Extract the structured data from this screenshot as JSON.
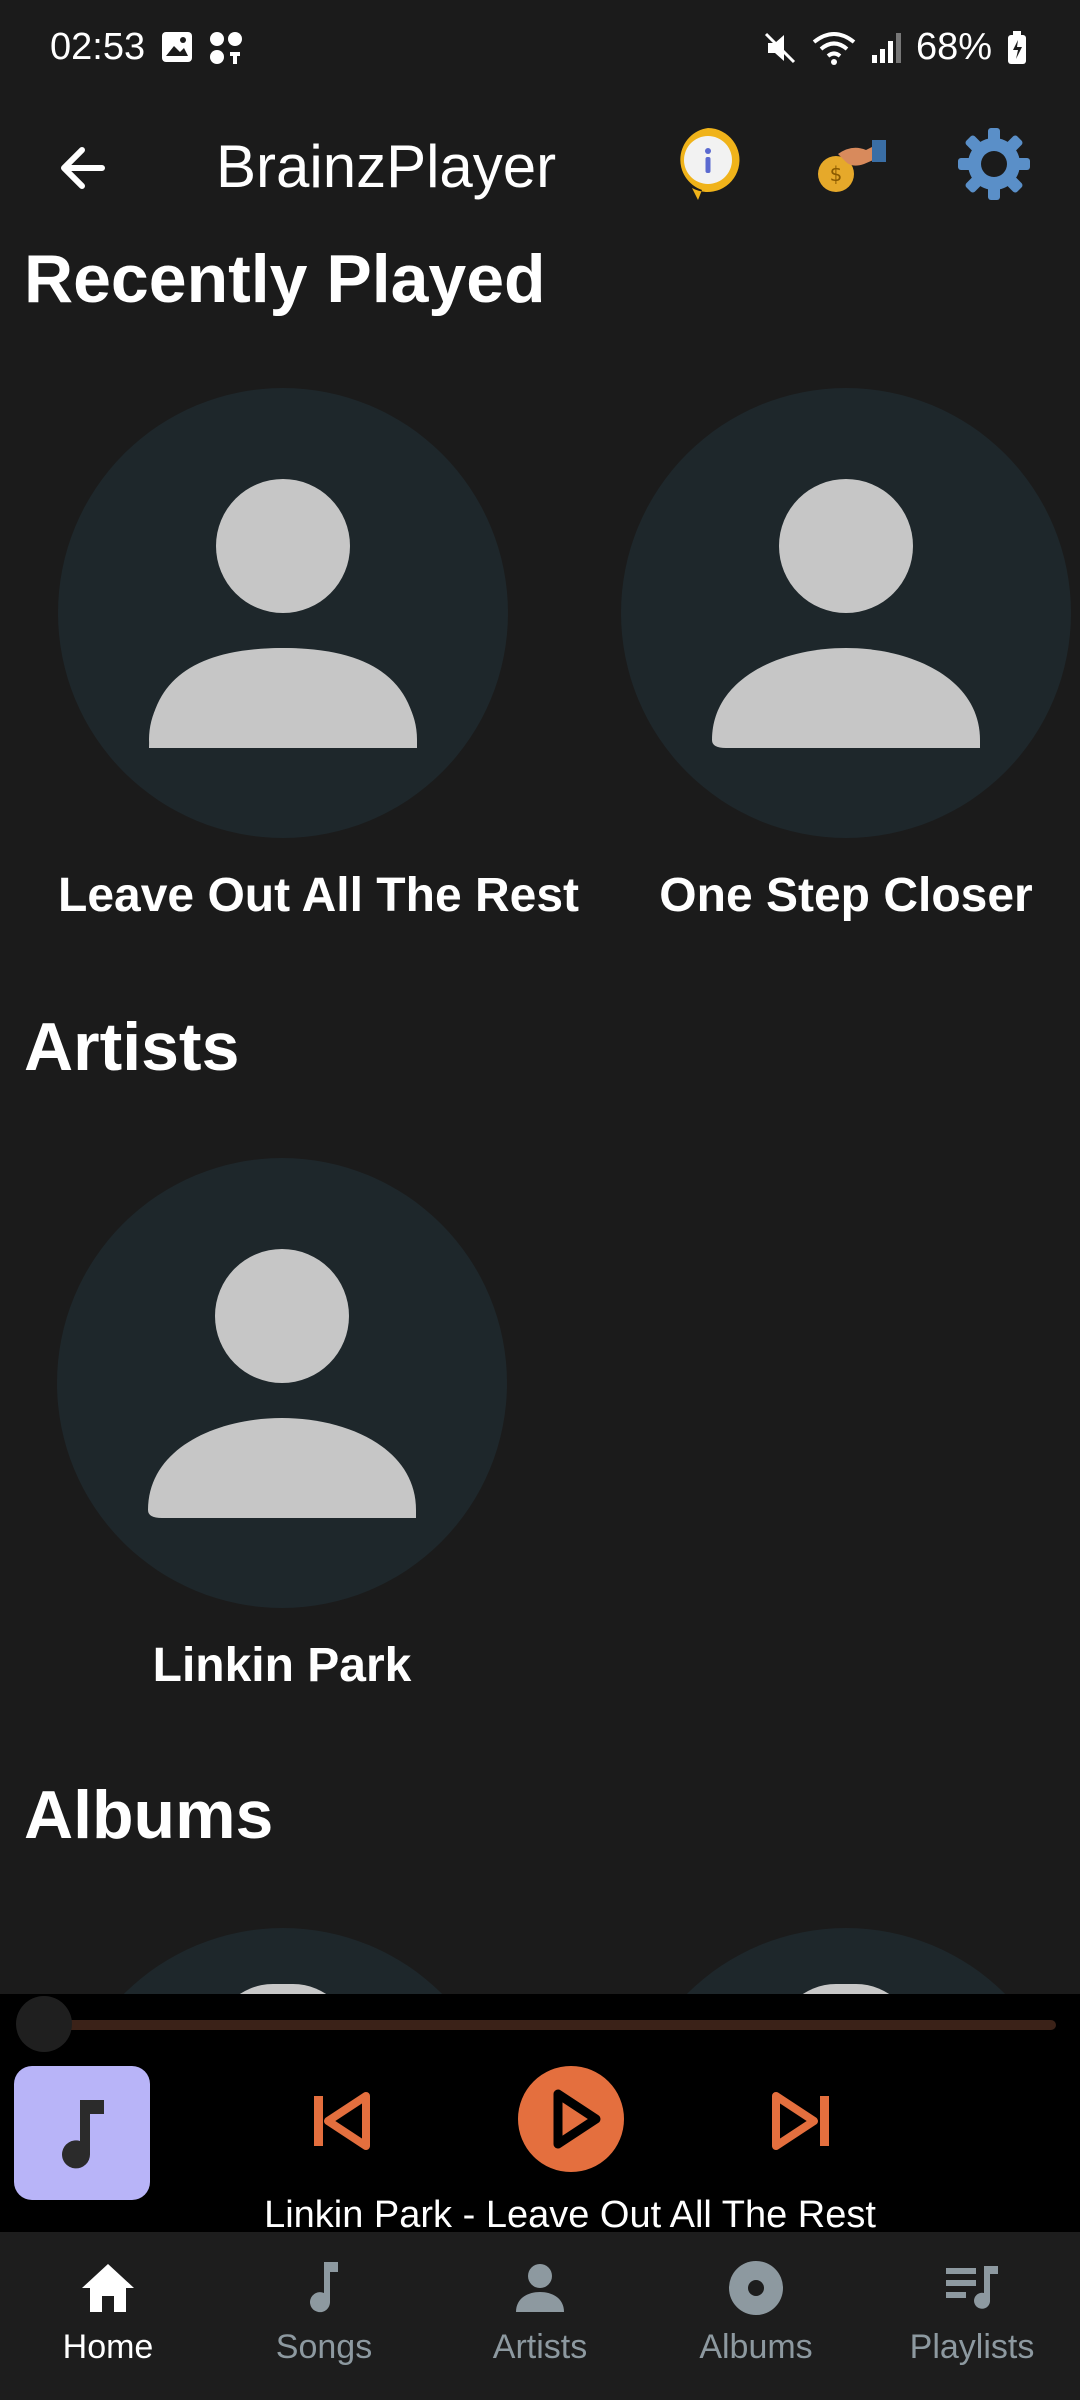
{
  "status_bar": {
    "time": "02:53",
    "battery": "68%",
    "icons": [
      "gallery-icon",
      "notification-dots-icon",
      "mute-icon",
      "wifi-icon",
      "signal-icon",
      "battery-icon"
    ]
  },
  "app_bar": {
    "title": "BrainzPlayer",
    "icons": [
      "back-arrow-icon",
      "info-icon",
      "donate-icon",
      "settings-gear-icon"
    ]
  },
  "sections": {
    "recently_played": {
      "title": "Recently Played",
      "items": [
        {
          "label": "Leave Out All The Rest",
          "icon": "person-icon"
        },
        {
          "label": "One Step Closer",
          "icon": "person-icon"
        }
      ]
    },
    "artists": {
      "title": "Artists",
      "items": [
        {
          "label": "Linkin Park",
          "icon": "person-icon"
        }
      ]
    },
    "albums": {
      "title": "Albums"
    }
  },
  "player": {
    "now_playing": "Linkin Park - Leave Out All The Rest",
    "progress": 0,
    "accent_color": "#e46f3e",
    "thumb_color": "#b8b4f8"
  },
  "bottom_nav": {
    "items": [
      {
        "label": "Home",
        "icon": "home-icon",
        "active": true
      },
      {
        "label": "Songs",
        "icon": "music-note-icon",
        "active": false
      },
      {
        "label": "Artists",
        "icon": "person-icon",
        "active": false
      },
      {
        "label": "Albums",
        "icon": "disc-icon",
        "active": false
      },
      {
        "label": "Playlists",
        "icon": "playlist-icon",
        "active": false
      }
    ]
  }
}
